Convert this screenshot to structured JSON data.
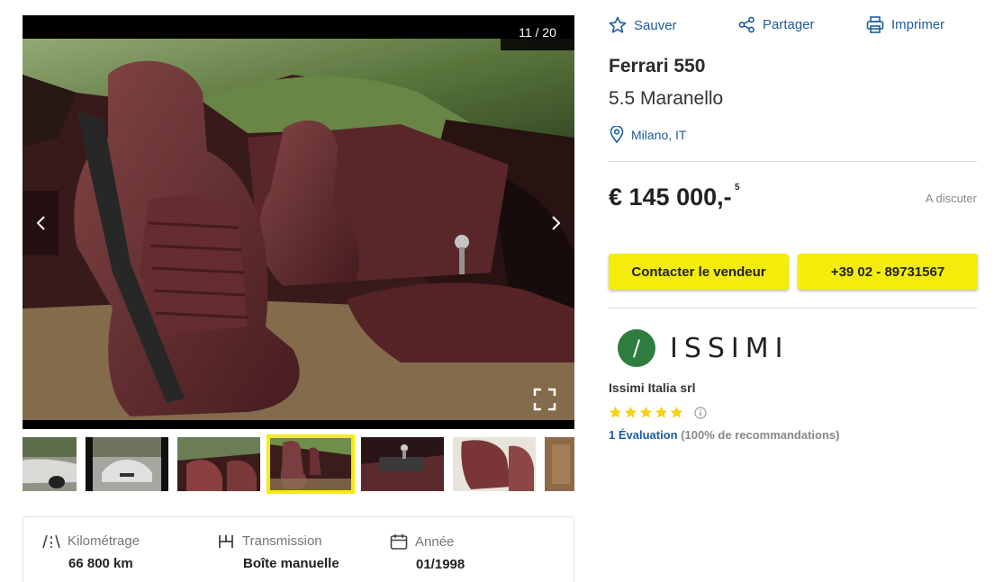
{
  "gallery": {
    "counter": "11 / 20",
    "prev_icon": "chevron-left-icon",
    "next_icon": "chevron-right-icon",
    "fullscreen_icon": "fullscreen-icon",
    "thumbnail_count": 6,
    "active_thumbnail": 4
  },
  "actions": {
    "save": "Sauver",
    "share": "Partager",
    "print": "Imprimer"
  },
  "listing": {
    "title": "Ferrari 550",
    "subtitle": "5.5 Maranello",
    "location": "Milano, IT",
    "price": "€ 145 000,-",
    "price_footnote": "5",
    "negotiable": "A discuter"
  },
  "buttons": {
    "contact": "Contacter le vendeur",
    "phone": "+39 02 - 89731567"
  },
  "dealer": {
    "logo_text": "ISSIMI",
    "logo_mark": "/",
    "name": "Issimi Italia srl",
    "stars": 5,
    "reviews_link": "1 Évaluation",
    "recommendation": "(100% de recommandations)"
  },
  "specs": [
    {
      "label": "Kilométrage",
      "value": "66 800 km",
      "icon": "road-icon"
    },
    {
      "label": "Transmission",
      "value": "Boîte manuelle",
      "icon": "gearbox-icon"
    },
    {
      "label": "Année",
      "value": "01/1998",
      "icon": "calendar-icon"
    }
  ],
  "colors": {
    "accent_yellow": "#f4ec0b",
    "link_blue": "#1a5c9e",
    "star_yellow": "#f3d31a",
    "logo_green": "#2e7d3e"
  }
}
